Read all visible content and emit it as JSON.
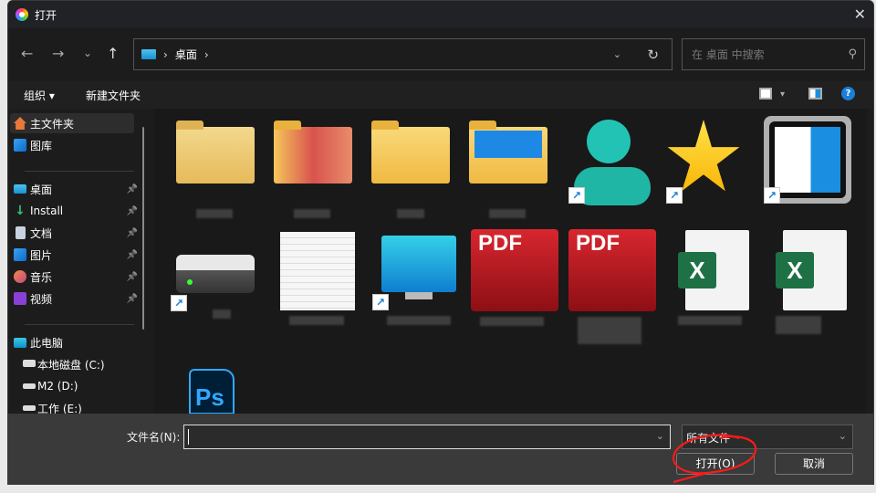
{
  "window": {
    "title": "打开",
    "close": "✕"
  },
  "nav": {
    "back": "←",
    "forward": "→",
    "recent": "⌄",
    "up": "↑"
  },
  "address": {
    "crumbs": [
      "桌面"
    ],
    "separator": "›",
    "dropdown": "⌄",
    "refresh": "↻"
  },
  "search": {
    "placeholder": "在 桌面 中搜索",
    "icon": "⚲"
  },
  "toolbar": {
    "organize": "组织 ▾",
    "new_folder": "新建文件夹",
    "view_dropdown": "▾",
    "help": "?"
  },
  "sidebar": {
    "quick": [
      {
        "label": "主文件夹",
        "icon": "home-icon",
        "selected": true
      },
      {
        "label": "图库",
        "icon": "gallery-icon"
      }
    ],
    "pinned": [
      {
        "label": "桌面",
        "icon": "desktop-icon"
      },
      {
        "label": "Install",
        "icon": "download-icon"
      },
      {
        "label": "文档",
        "icon": "documents-icon"
      },
      {
        "label": "图片",
        "icon": "pictures-icon"
      },
      {
        "label": "音乐",
        "icon": "music-icon"
      },
      {
        "label": "视频",
        "icon": "videos-icon"
      }
    ],
    "pin_glyph": "📌",
    "this_pc": "此电脑",
    "drives": [
      {
        "label": "本地磁盘 (C:)"
      },
      {
        "label": "M2 (D:)"
      },
      {
        "label": "工作 (E:)"
      }
    ]
  },
  "files": {
    "pdf_label": "PDF",
    "excel_label": "X",
    "ps_label": "Ps",
    "shortcut_glyph": "↗"
  },
  "footer": {
    "filename_label": "文件名(N):",
    "filename_value": "",
    "filetype": "所有文件",
    "open": "打开(O)",
    "cancel": "取消",
    "dropdown": "⌄"
  },
  "colors": {
    "annotation": "#ff1a1a",
    "accent": "#1a7fd6"
  }
}
